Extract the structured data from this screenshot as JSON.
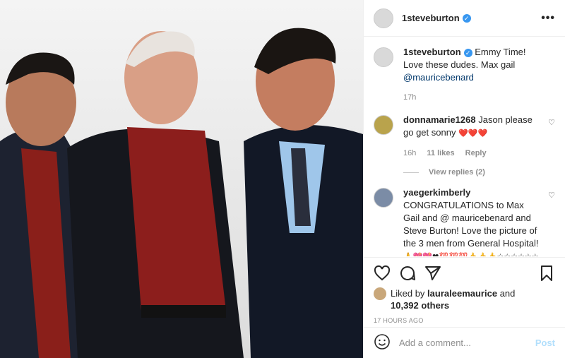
{
  "post": {
    "username": "1steveburton",
    "more_label": "•••",
    "verified_glyph": "✓"
  },
  "caption": {
    "username": "1steveburton",
    "text": "Emmy Time! Love these dudes. Max gail",
    "mention": "@mauricebenard",
    "time": "17h"
  },
  "comments": [
    {
      "username": "donnamarie1268",
      "text": "Jason please go get sonny",
      "emoji": "❤️❤️❤️",
      "time": "16h",
      "likes": "11 likes",
      "reply": "Reply",
      "view_replies": "View replies (2)"
    },
    {
      "username": "yaegerkimberly",
      "text": "CONGRATULATIONS to Max Gail and @ mauricebenard and Steve Burton! Love the picture of the 3 men from General Hospital!",
      "emoji": "🙏💖💖❤💯💯💯👍👍👍☆☆☆☆☆☆👏👏👏👏👏👏"
    }
  ],
  "likes": {
    "prefix": "Liked by",
    "user": "lauraleemaurice",
    "and": "and",
    "others": "10,392 others"
  },
  "timestamp": "17 HOURS AGO",
  "add_comment": {
    "placeholder": "Add a comment...",
    "post_label": "Post"
  },
  "icons": {
    "like": "heart-icon",
    "comment": "comment-icon",
    "share": "share-icon",
    "save": "bookmark-icon",
    "emoji": "emoji-icon"
  },
  "colors": {
    "verified": "#3897f0",
    "post_button": "#b2dffc",
    "link": "#00376b"
  }
}
